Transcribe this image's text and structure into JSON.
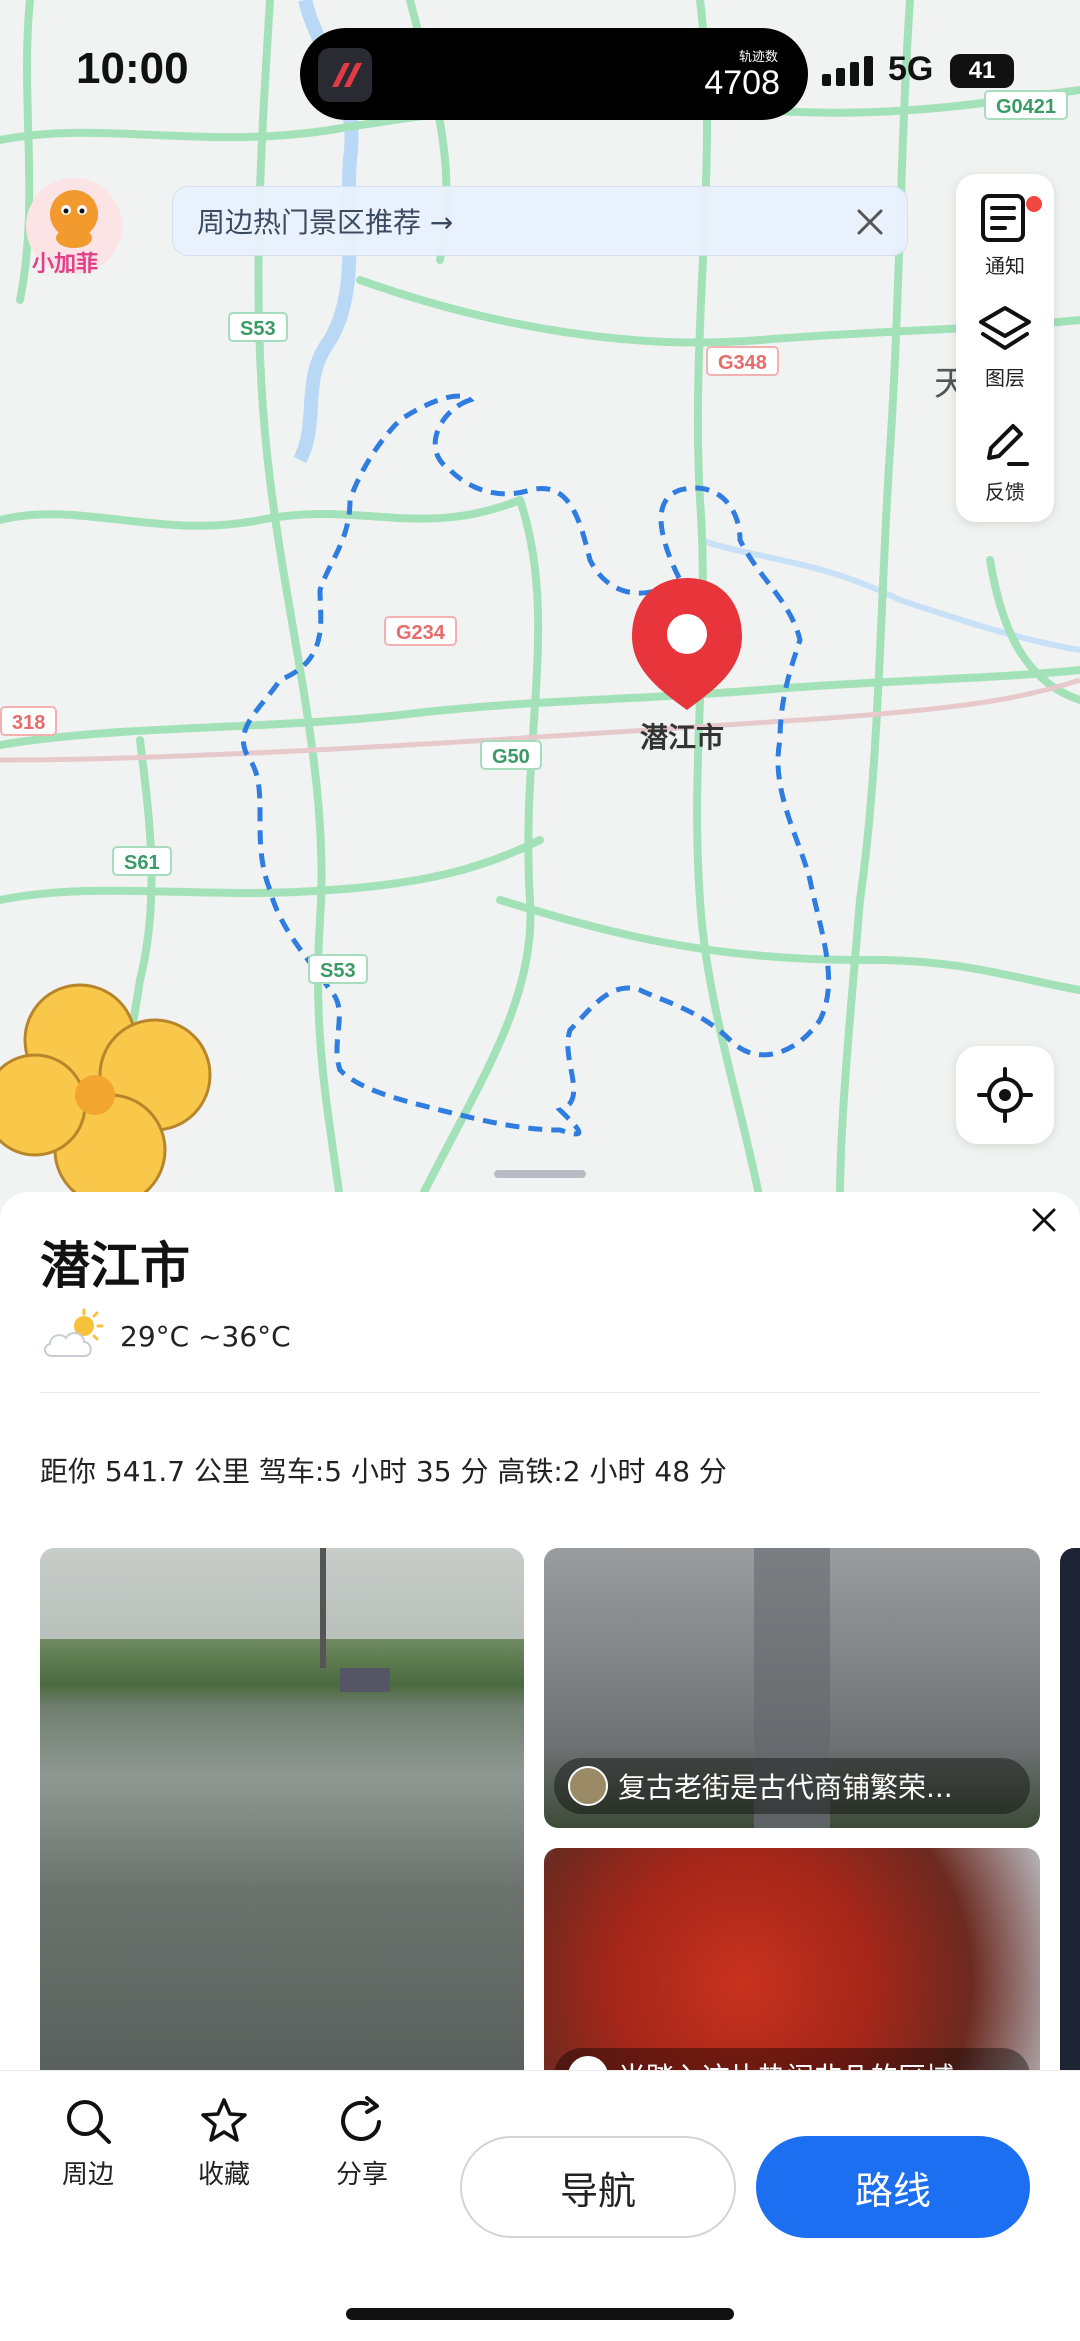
{
  "status_bar": {
    "time": "10:00",
    "network": "5G",
    "battery": "41"
  },
  "island": {
    "caption": "轨迹数",
    "count": "4708"
  },
  "map": {
    "banner_text": "周边热门景区推荐 →",
    "mascot_label": "小加菲",
    "pin_label": "潜江市",
    "edge_label": "天",
    "road_badges": [
      "G0421",
      "S53",
      "G348",
      "G234",
      "G50",
      "S61",
      "S53",
      "318"
    ],
    "tools": [
      {
        "icon": "notification-icon",
        "label": "通知"
      },
      {
        "icon": "layers-icon",
        "label": "图层"
      },
      {
        "icon": "feedback-icon",
        "label": "反馈"
      }
    ],
    "colors": {
      "route": "#2f7de1",
      "pin": "#e8353c",
      "roads": "#9fe0b4"
    }
  },
  "place": {
    "title": "潜江市",
    "weather": "29°C ~36°C",
    "distance": "距你 541.7 公里  驾车:5 小时 35 分  高铁:2 小时 48 分",
    "photos": [
      {
        "caption": ""
      },
      {
        "caption": "复古老街是古代商铺繁荣..."
      },
      {
        "caption": "当踏入这片热闹非凡的区域"
      }
    ]
  },
  "bottom_bar": {
    "actions": [
      {
        "icon": "search-icon",
        "label": "周边"
      },
      {
        "icon": "star-icon",
        "label": "收藏"
      },
      {
        "icon": "share-icon",
        "label": "分享"
      }
    ],
    "nav_button": "导航",
    "route_button": "路线"
  }
}
